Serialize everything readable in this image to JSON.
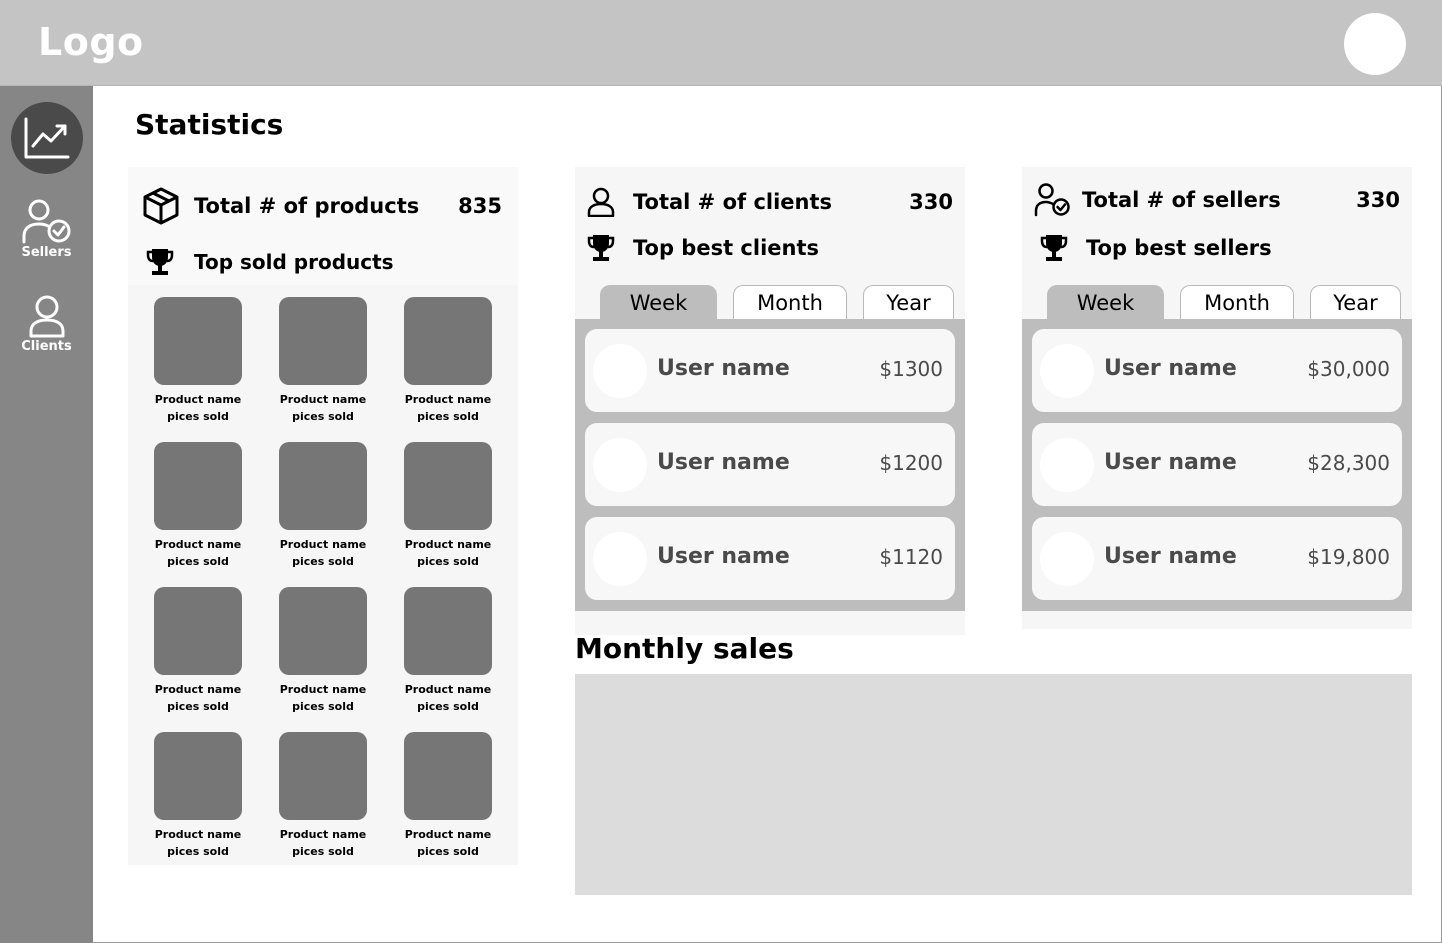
{
  "header": {
    "logo": "Logo",
    "avatar": "avatar"
  },
  "sidebar": {
    "items": [
      {
        "id": "statistics",
        "label": "",
        "icon": "trend-chart-icon",
        "active": true
      },
      {
        "id": "sellers",
        "label": "Sellers",
        "icon": "user-badge-icon"
      },
      {
        "id": "clients",
        "label": "Clients",
        "icon": "user-icon"
      }
    ]
  },
  "page": {
    "title": "Statistics"
  },
  "products": {
    "icon": "box-icon",
    "title": "Total # of products",
    "count": "835",
    "top_icon": "trophy-icon",
    "top_label": "Top sold products",
    "items": [
      {
        "name": "Product name",
        "sold": "pices sold"
      },
      {
        "name": "Product name",
        "sold": "pices sold"
      },
      {
        "name": "Product name",
        "sold": "pices sold"
      },
      {
        "name": "Product name",
        "sold": "pices sold"
      },
      {
        "name": "Product name",
        "sold": "pices sold"
      },
      {
        "name": "Product name",
        "sold": "pices sold"
      },
      {
        "name": "Product name",
        "sold": "pices sold"
      },
      {
        "name": "Product name",
        "sold": "pices sold"
      },
      {
        "name": "Product name",
        "sold": "pices sold"
      },
      {
        "name": "Product name",
        "sold": "pices sold"
      },
      {
        "name": "Product name",
        "sold": "pices sold"
      },
      {
        "name": "Product name",
        "sold": "pices sold"
      }
    ]
  },
  "clients": {
    "icon": "user-icon",
    "title": "Total # of clients",
    "count": "330",
    "top_icon": "trophy-icon",
    "top_label": "Top best clients",
    "tabs": [
      {
        "label": "Week",
        "active": true
      },
      {
        "label": "Month",
        "active": false
      },
      {
        "label": "Year",
        "active": false
      }
    ],
    "rows": [
      {
        "name": "User name",
        "amount": "$1300"
      },
      {
        "name": "User name",
        "amount": "$1200"
      },
      {
        "name": "User name",
        "amount": "$1120"
      }
    ]
  },
  "sellers": {
    "icon": "user-badge-icon",
    "title": "Total # of sellers",
    "count": "330",
    "top_icon": "trophy-icon",
    "top_label": "Top best sellers",
    "tabs": [
      {
        "label": "Week",
        "active": true
      },
      {
        "label": "Month",
        "active": false
      },
      {
        "label": "Year",
        "active": false
      }
    ],
    "rows": [
      {
        "name": "User name",
        "amount": "$30,000"
      },
      {
        "name": "User name",
        "amount": "$28,300"
      },
      {
        "name": "User name",
        "amount": "$19,800"
      }
    ]
  },
  "monthly_sales": {
    "title": "Monthly sales"
  },
  "colors": {
    "topbar": "#c4c4c4",
    "sidebar": "#868686",
    "active_nav": "#4a4a4a",
    "thumb": "#767676",
    "rank_list_bg": "#bdbdbd",
    "chart_placeholder": "#dcdcdc"
  }
}
